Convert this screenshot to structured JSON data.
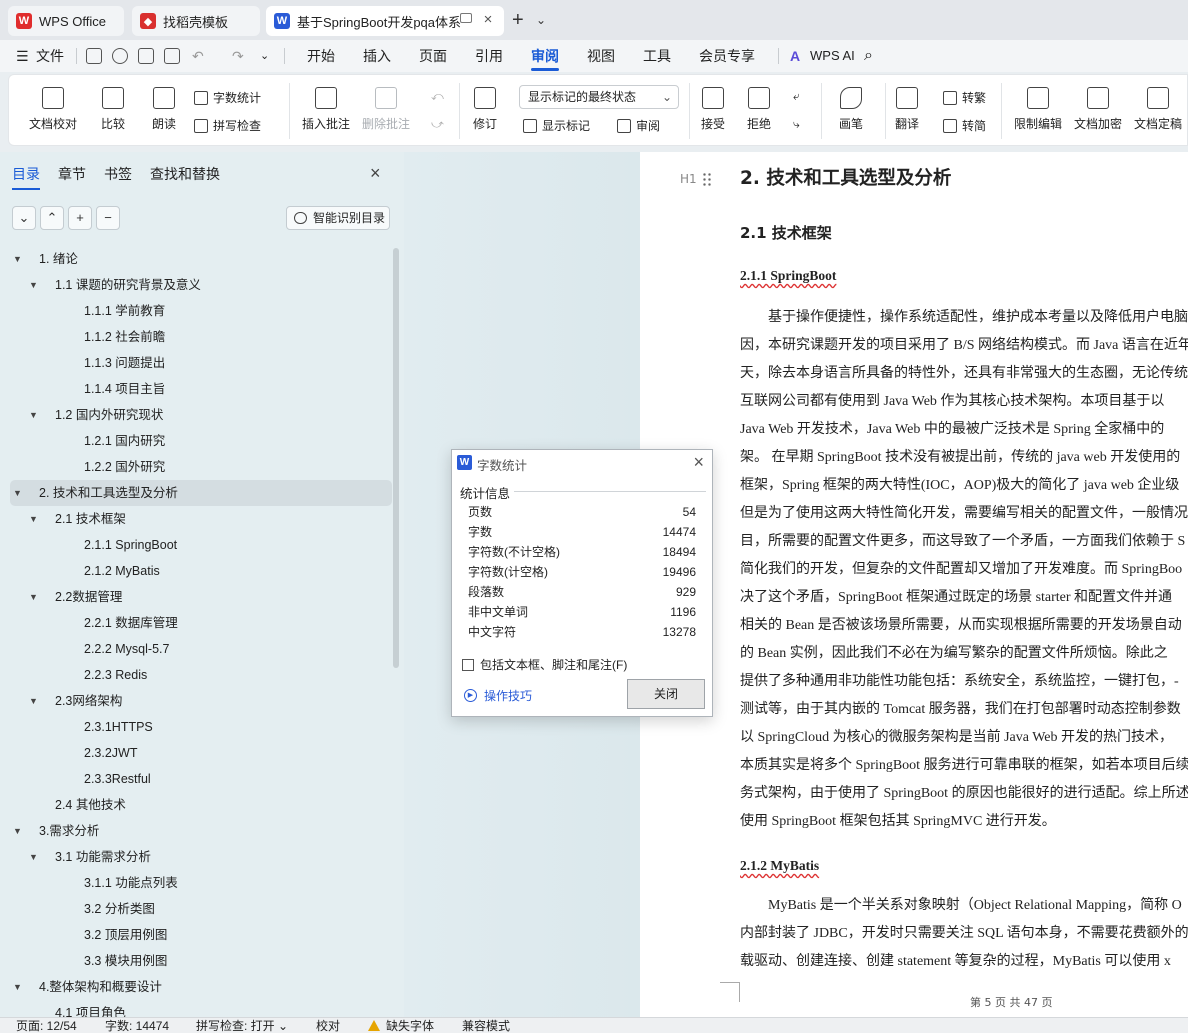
{
  "tabs": [
    {
      "label": "WPS Office"
    },
    {
      "label": "找稻壳模板"
    },
    {
      "label": "基于SpringBoot开发pqa体系"
    }
  ],
  "menu": {
    "file": "文件",
    "items": [
      "开始",
      "插入",
      "页面",
      "引用",
      "审阅",
      "视图",
      "工具",
      "会员专享"
    ],
    "active": "审阅",
    "ai": "WPS AI"
  },
  "ribbon": {
    "doc_check": "文档校对",
    "compare": "比较",
    "read_aloud": "朗读",
    "word_count": "字数统计",
    "spell_check": "拼写检查",
    "insert_comment": "插入批注",
    "delete_comment": "删除批注",
    "revise": "修订",
    "markup_select": "显示标记的最终状态",
    "show_markup": "显示标记",
    "review": "审阅",
    "accept": "接受",
    "reject": "拒绝",
    "pen": "画笔",
    "translate": "翻译",
    "to_traditional": "转繁",
    "to_simplified": "转简",
    "restrict_edit": "限制编辑",
    "doc_encrypt": "文档加密",
    "doc_finalize": "文档定稿"
  },
  "nav": {
    "tabs": [
      "目录",
      "章节",
      "书签",
      "查找和替换"
    ],
    "smart_toc": "智能识别目录",
    "toc": [
      {
        "label": "1. 绪论",
        "level": 1,
        "caret": true
      },
      {
        "label": "1.1 课题的研究背景及意义",
        "level": 2,
        "caret": true
      },
      {
        "label": "1.1.1  学前教育",
        "level": 3
      },
      {
        "label": "1.1.2  社会前瞻",
        "level": 3
      },
      {
        "label": "1.1.3  问题提出",
        "level": 3
      },
      {
        "label": "1.1.4  项目主旨",
        "level": 3
      },
      {
        "label": "1.2  国内外研究现状",
        "level": 2,
        "caret": true
      },
      {
        "label": "1.2.1  国内研究",
        "level": 3
      },
      {
        "label": "1.2.2 国外研究",
        "level": 3
      },
      {
        "label": "2.  技术和工具选型及分析",
        "level": 1,
        "caret": true,
        "selected": true
      },
      {
        "label": "2.1  技术框架",
        "level": 2,
        "caret": true
      },
      {
        "label": "2.1.1 SpringBoot",
        "level": 3
      },
      {
        "label": "2.1.2 MyBatis",
        "level": 3
      },
      {
        "label": "2.2数据管理",
        "level": 2,
        "caret": true
      },
      {
        "label": "2.2.1  数据库管理",
        "level": 3
      },
      {
        "label": "2.2.2 Mysql-5.7",
        "level": 3
      },
      {
        "label": "2.2.3 Redis",
        "level": 3
      },
      {
        "label": "2.3网络架构",
        "level": 2,
        "caret": true
      },
      {
        "label": "2.3.1HTTPS",
        "level": 3
      },
      {
        "label": "2.3.2JWT",
        "level": 3
      },
      {
        "label": "2.3.3Restful",
        "level": 3
      },
      {
        "label": "2.4 其他技术",
        "level": 2
      },
      {
        "label": "3.需求分析",
        "level": 1,
        "caret": true
      },
      {
        "label": "3.1 功能需求分析",
        "level": 2,
        "caret": true
      },
      {
        "label": "3.1.1  功能点列表",
        "level": 3
      },
      {
        "label": "3.2  分析类图",
        "level": 3
      },
      {
        "label": "3.2  顶层用例图",
        "level": 3
      },
      {
        "label": "3.3  模块用例图",
        "level": 3
      },
      {
        "label": "4.整体架构和概要设计",
        "level": 1,
        "caret": true
      },
      {
        "label": "4.1  项目角色",
        "level": 2
      }
    ]
  },
  "document": {
    "heading_marker": "H1",
    "h1": "2.  技术和工具选型及分析",
    "h2": "2.1  技术框架",
    "h3a": "2.1.1 SpringBoot",
    "paraA": [
      "　　基于操作便捷性，操作系统适配性，维护成本考量以及降低用户电脑",
      "因，本研究课题开发的项目采用了 B/S 网络结构模式。而 Java 语言在近年",
      "天，除去本身语言所具备的特性外，还具有非常强大的生态圈，无论传统",
      "互联网公司都有使用到 Java Web 作为其核心技术架构。本项目基于以",
      "Java Web 开发技术，Java Web 中的最被广泛技术是 Spring 全家桶中的",
      "架。 在早期 SpringBoot 技术没有被提出前，传统的 java web 开发使用的",
      "框架，Spring 框架的两大特性(IOC，AOP)极大的简化了 java web 企业级",
      "但是为了使用这两大特性简化开发，需要编写相关的配置文件，一般情况",
      "目，所需要的配置文件更多，而这导致了一个矛盾，一方面我们依赖于 S",
      "简化我们的开发，但复杂的文件配置却又增加了开发难度。而 SpringBoo",
      "决了这个矛盾，SpringBoot 框架通过既定的场景 starter 和配置文件并通",
      "相关的 Bean 是否被该场景所需要，从而实现根据所需要的开发场景自动",
      "的 Bean 实例，因此我们不必在为编写繁杂的配置文件所烦恼。除此之",
      "提供了多种通用非功能性功能包括：系统安全，系统监控，一键打包，-",
      "测试等，由于其内嵌的 Tomcat 服务器，我们在打包部署时动态控制参数",
      "以 SpringCloud 为核心的微服务架构是当前 Java Web 开发的热门技术，",
      "本质其实是将多个 SpringBoot 服务进行可靠串联的框架，如若本项目后续",
      "务式架构，由于使用了 SpringBoot 的原因也能很好的进行适配。综上所述",
      "使用 SpringBoot 框架包括其 SpringMVC 进行开发。"
    ],
    "h3b": "2.1.2 MyBatis",
    "paraB": [
      "　　MyBatis 是一个半关系对象映射（Object Relational Mapping，简称 O",
      "内部封装了 JDBC，开发时只需要关注 SQL 语句本身，不需要花费额外的",
      "载驱动、创建连接、创建 statement 等复杂的过程，MyBatis 可以使用 x"
    ],
    "footer": "第 5 页 共 47 页"
  },
  "dialog": {
    "title": "字数统计",
    "section": "统计信息",
    "stats": [
      {
        "label": "页数",
        "value": "54"
      },
      {
        "label": "字数",
        "value": "14474"
      },
      {
        "label": "字符数(不计空格)",
        "value": "18494"
      },
      {
        "label": "字符数(计空格)",
        "value": "19496"
      },
      {
        "label": "段落数",
        "value": "929"
      },
      {
        "label": "非中文单词",
        "value": "1196"
      },
      {
        "label": "中文字符",
        "value": "13278"
      }
    ],
    "checkbox": "包括文本框、脚注和尾注(F)",
    "tips": "操作技巧",
    "close": "关闭"
  },
  "status": {
    "page": "页面: 12/54",
    "words": "字数: 14474",
    "spell": "拼写检查: 打开",
    "proof": "校对",
    "missing_font": "缺失字体",
    "compat": "兼容模式"
  },
  "colors": {
    "accent": "#1a5bd6",
    "wps_red": "#e02d2d",
    "template_red": "#d9302f",
    "doc_blue": "#2a5bd7"
  }
}
